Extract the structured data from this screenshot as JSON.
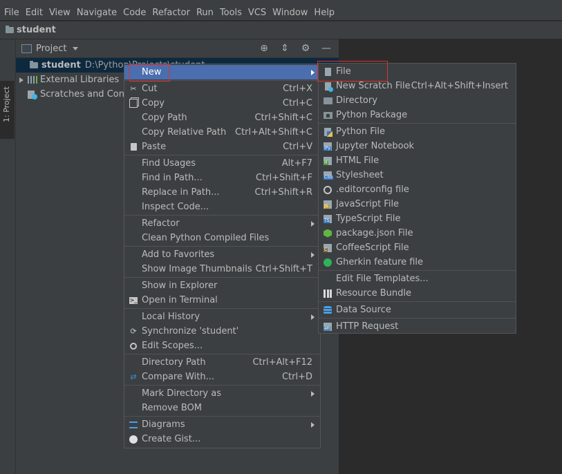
{
  "menubar": [
    {
      "label": "File"
    },
    {
      "label": "Edit"
    },
    {
      "label": "View"
    },
    {
      "label": "Navigate"
    },
    {
      "label": "Code"
    },
    {
      "label": "Refactor"
    },
    {
      "label": "Run"
    },
    {
      "label": "Tools"
    },
    {
      "label": "VCS"
    },
    {
      "label": "Window"
    },
    {
      "label": "Help"
    }
  ],
  "navbar": {
    "crumb": "student"
  },
  "sidestrip": {
    "tab": "1: Project"
  },
  "panel": {
    "title": "Project",
    "tree": {
      "root_name": "student",
      "root_path": "D:\\Python\\Projects\\student",
      "external": "External Libraries",
      "scratches": "Scratches and Consoles"
    }
  },
  "context_menu": {
    "new": "New",
    "groups": [
      [
        {
          "label": "Cut",
          "shortcut": "Ctrl+X"
        },
        {
          "label": "Copy",
          "shortcut": "Ctrl+C"
        },
        {
          "label": "Copy Path",
          "shortcut": "Ctrl+Shift+C"
        },
        {
          "label": "Copy Relative Path",
          "shortcut": "Ctrl+Alt+Shift+C"
        },
        {
          "label": "Paste",
          "shortcut": "Ctrl+V"
        }
      ],
      [
        {
          "label": "Find Usages",
          "shortcut": "Alt+F7"
        },
        {
          "label": "Find in Path...",
          "shortcut": "Ctrl+Shift+F"
        },
        {
          "label": "Replace in Path...",
          "shortcut": "Ctrl+Shift+R"
        },
        {
          "label": "Inspect Code...",
          "shortcut": ""
        }
      ],
      [
        {
          "label": "Refactor",
          "shortcut": ""
        },
        {
          "label": "Clean Python Compiled Files",
          "shortcut": ""
        }
      ],
      [
        {
          "label": "Add to Favorites",
          "shortcut": ""
        },
        {
          "label": "Show Image Thumbnails",
          "shortcut": "Ctrl+Shift+T"
        }
      ],
      [
        {
          "label": "Show in Explorer",
          "shortcut": ""
        },
        {
          "label": "Open in Terminal",
          "shortcut": ""
        }
      ],
      [
        {
          "label": "Local History",
          "shortcut": ""
        },
        {
          "label": "Synchronize 'student'",
          "shortcut": ""
        },
        {
          "label": "Edit Scopes...",
          "shortcut": ""
        }
      ],
      [
        {
          "label": "Directory Path",
          "shortcut": "Ctrl+Alt+F12"
        },
        {
          "label": "Compare With...",
          "shortcut": "Ctrl+D"
        }
      ],
      [
        {
          "label": "Mark Directory as",
          "shortcut": ""
        },
        {
          "label": "Remove BOM",
          "shortcut": ""
        }
      ],
      [
        {
          "label": "Diagrams",
          "shortcut": ""
        },
        {
          "label": "Create Gist...",
          "shortcut": ""
        }
      ]
    ]
  },
  "submenu": {
    "items": [
      {
        "label": "File",
        "shortcut": ""
      },
      {
        "label": "New Scratch File",
        "shortcut": "Ctrl+Alt+Shift+Insert"
      },
      {
        "label": "Directory",
        "shortcut": ""
      },
      {
        "label": "Python Package",
        "shortcut": ""
      },
      {
        "label": "Python File",
        "shortcut": ""
      },
      {
        "label": "Jupyter Notebook",
        "shortcut": ""
      },
      {
        "label": "HTML File",
        "shortcut": ""
      },
      {
        "label": "Stylesheet",
        "shortcut": ""
      },
      {
        "label": ".editorconfig file",
        "shortcut": ""
      },
      {
        "label": "JavaScript File",
        "shortcut": ""
      },
      {
        "label": "TypeScript File",
        "shortcut": ""
      },
      {
        "label": "package.json File",
        "shortcut": ""
      },
      {
        "label": "CoffeeScript File",
        "shortcut": ""
      },
      {
        "label": "Gherkin feature file",
        "shortcut": ""
      },
      {
        "label": "Edit File Templates...",
        "shortcut": ""
      },
      {
        "label": "Resource Bundle",
        "shortcut": ""
      },
      {
        "label": "Data Source",
        "shortcut": ""
      },
      {
        "label": "HTTP Request",
        "shortcut": ""
      }
    ]
  },
  "colors": {
    "highlight": "#4b6eaf",
    "annotation": "#e03030",
    "background": "#2b2b2b",
    "panel": "#3c3f41"
  }
}
